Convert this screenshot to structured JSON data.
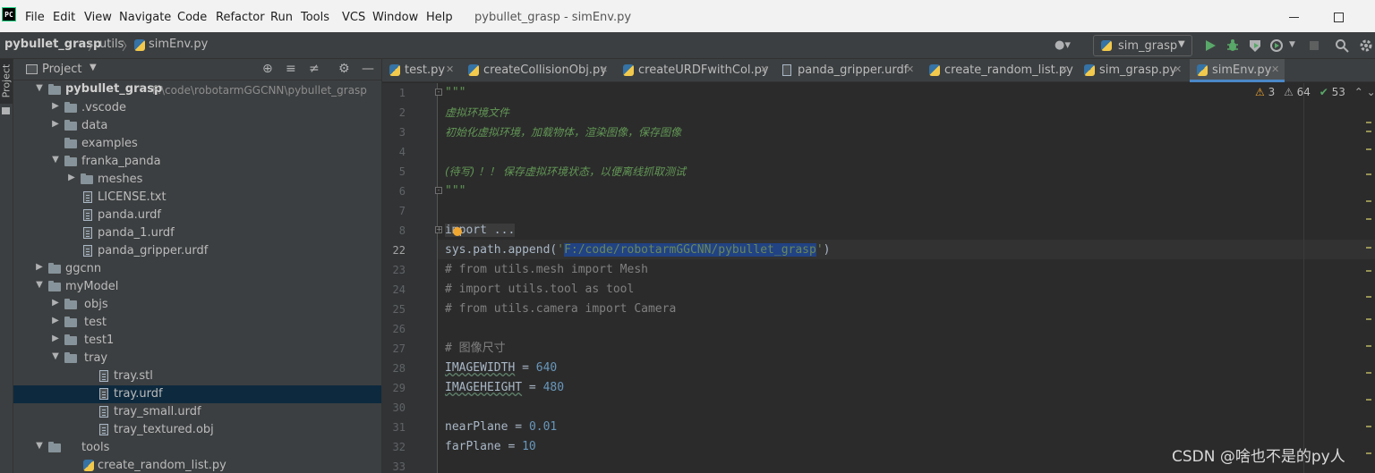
{
  "app": {
    "logo": "PC",
    "window_title": "pybullet_grasp - simEnv.py"
  },
  "menu": [
    "File",
    "Edit",
    "View",
    "Navigate",
    "Code",
    "Refactor",
    "Run",
    "Tools",
    "VCS",
    "Window",
    "Help"
  ],
  "breadcrumb": {
    "project": "pybullet_grasp",
    "folder": "utils",
    "file": "simEnv.py"
  },
  "run_config": {
    "label": "sim_grasp",
    "colors": {
      "run": "#59a869",
      "debug": "#59a869"
    }
  },
  "project_panel": {
    "title": "Project",
    "stripe_label": "Project",
    "tree": [
      {
        "label": "pybullet_grasp",
        "path": "F:\\code\\robotarmGGCNN\\pybullet_grasp",
        "type": "folder",
        "expanded": true,
        "bold": true
      },
      {
        "label": ".vscode",
        "type": "folder",
        "expanded": false
      },
      {
        "label": "data",
        "type": "folder",
        "expanded": false
      },
      {
        "label": "examples",
        "type": "folder"
      },
      {
        "label": "franka_panda",
        "type": "folder",
        "expanded": true
      },
      {
        "label": "meshes",
        "type": "folder",
        "expanded": false
      },
      {
        "label": "LICENSE.txt",
        "type": "file"
      },
      {
        "label": "panda.urdf",
        "type": "file"
      },
      {
        "label": "panda_1.urdf",
        "type": "file"
      },
      {
        "label": "panda_gripper.urdf",
        "type": "file"
      },
      {
        "label": "ggcnn",
        "type": "folder",
        "expanded": false
      },
      {
        "label": "myModel",
        "type": "folder",
        "expanded": true
      },
      {
        "label": "objs",
        "type": "folder",
        "expanded": false
      },
      {
        "label": "test",
        "type": "folder",
        "expanded": false
      },
      {
        "label": "test1",
        "type": "folder",
        "expanded": false
      },
      {
        "label": "tray",
        "type": "folder",
        "expanded": true
      },
      {
        "label": "tray.stl",
        "type": "file"
      },
      {
        "label": "tray.urdf",
        "type": "file",
        "selected": true
      },
      {
        "label": "tray_small.urdf",
        "type": "file"
      },
      {
        "label": "tray_textured.obj",
        "type": "file"
      },
      {
        "label": "tools",
        "type": "folder",
        "expanded": true
      },
      {
        "label": "create_random_list.py",
        "type": "py"
      }
    ]
  },
  "tabs": [
    {
      "label": "test.py",
      "icon": "python-file-icon"
    },
    {
      "label": "createCollisionObj.py",
      "icon": "python-file-icon"
    },
    {
      "label": "createURDFwithCol.py",
      "icon": "python-file-icon"
    },
    {
      "label": "panda_gripper.urdf",
      "icon": "file-icon"
    },
    {
      "label": "create_random_list.py",
      "icon": "python-file-icon"
    },
    {
      "label": "sim_grasp.py",
      "icon": "python-file-icon"
    },
    {
      "label": "simEnv.py",
      "icon": "python-file-icon",
      "active": true
    }
  ],
  "inspections": {
    "warnings": "3",
    "weak_warnings": "64",
    "ok": "53"
  },
  "editor": {
    "line_numbers": [
      "1",
      "2",
      "3",
      "4",
      "5",
      "6",
      "7",
      "8",
      "22",
      "23",
      "24",
      "25",
      "26",
      "27",
      "28",
      "29",
      "30",
      "31",
      "32",
      "33"
    ],
    "current_line": "22",
    "lines": {
      "l1": "\"\"\"",
      "l2": "虚拟环境文件",
      "l3": "初始化虚拟环境，加载物体，渲染图像，保存图像",
      "l5": "(待写) ！！ 保存虚拟环境状态，以便离线抓取测试",
      "l6": "\"\"\"",
      "l8": "import ...",
      "l22_a": "sys.path.append(",
      "l22_q1": "'",
      "l22_sel": "F:/code/robotarmGGCNN/pybullet_grasp",
      "l22_q2": "'",
      "l22_b": ")",
      "l23": "# from utils.mesh import Mesh",
      "l24": "# import utils.tool as tool",
      "l25": "# from utils.camera import Camera",
      "l27": "# 图像尺寸",
      "l28_var": "IMAGEWIDTH",
      "l28_op": " = ",
      "l28_num": "640",
      "l29_var": "IMAGEHEIGHT",
      "l29_op": " = ",
      "l29_num": "480",
      "l31_var": "nearPlane",
      "l31_op": " = ",
      "l31_num": "0.01",
      "l32_var": "farPlane",
      "l32_op": " = ",
      "l32_num": "10"
    }
  },
  "watermark": "CSDN @啥也不是的py人"
}
